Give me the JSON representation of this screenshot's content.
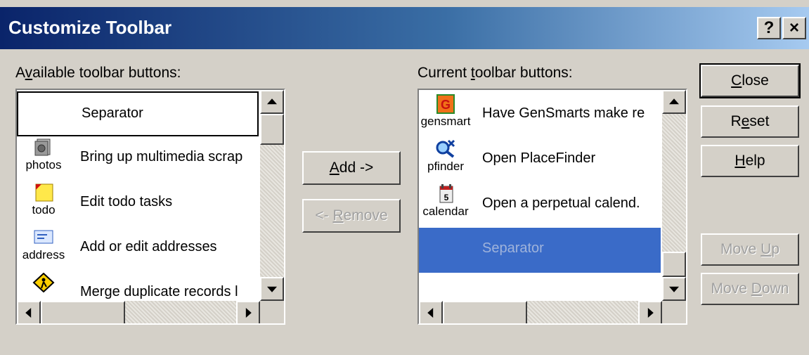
{
  "window": {
    "title": "Customize Toolbar",
    "help_label": "?",
    "close_label": "×"
  },
  "available": {
    "label_pre": "A",
    "label_key": "v",
    "label_post": "ailable toolbar buttons:",
    "items": [
      {
        "icon": "",
        "caption": "",
        "text": "Separator"
      },
      {
        "icon": "photos-icon",
        "caption": "photos",
        "text": "Bring up multimedia scrap"
      },
      {
        "icon": "todo-icon",
        "caption": "todo",
        "text": "Edit todo tasks"
      },
      {
        "icon": "address-icon",
        "caption": "address",
        "text": "Add or edit addresses"
      },
      {
        "icon": "merge-icon",
        "caption": "",
        "text": "Merge duplicate records l"
      }
    ]
  },
  "current": {
    "label_pre": "Current ",
    "label_key": "t",
    "label_post": "oolbar buttons:",
    "items": [
      {
        "icon": "gensmarts-icon",
        "caption": "gensmart",
        "text": "Have GenSmarts make re"
      },
      {
        "icon": "placefinder-icon",
        "caption": "pfinder",
        "text": "Open PlaceFinder"
      },
      {
        "icon": "calendar-icon",
        "caption": "calendar",
        "text": "Open a perpetual calend."
      },
      {
        "icon": "",
        "caption": "",
        "text": "Separator"
      }
    ]
  },
  "buttons": {
    "add_key": "A",
    "add_rest": "dd ->",
    "remove_pre": "<- ",
    "remove_key": "R",
    "remove_rest": "emove",
    "close_key": "C",
    "close_rest": "lose",
    "reset_pre": "R",
    "reset_key": "e",
    "reset_rest": "set",
    "help_key": "H",
    "help_rest": "elp",
    "moveup_pre": "Move ",
    "moveup_key": "U",
    "moveup_rest": "p",
    "movedown_pre": "Move ",
    "movedown_key": "D",
    "movedown_rest": "own"
  },
  "colors": {
    "title_start": "#0a246a",
    "title_end": "#a6caf0",
    "selection": "#3a6bc8",
    "face": "#d4d0c8"
  }
}
